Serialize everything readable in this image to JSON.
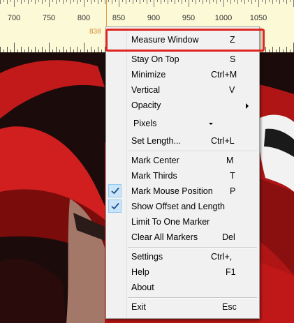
{
  "ruler": {
    "labels": [
      "700",
      "750",
      "800",
      "850",
      "900",
      "950",
      "1000",
      "1050"
    ],
    "mouse_position": "838"
  },
  "menu": {
    "items": [
      {
        "label": "Measure Window",
        "shortcut": "Z"
      },
      {
        "label": "Stay On Top",
        "shortcut": "S"
      },
      {
        "label": "Minimize",
        "shortcut": "Ctrl+M"
      },
      {
        "label": "Vertical",
        "shortcut": "V"
      },
      {
        "label": "Opacity",
        "shortcut": ""
      },
      {
        "label": "Set Length...",
        "shortcut": "Ctrl+L"
      },
      {
        "label": "Mark Center",
        "shortcut": "M"
      },
      {
        "label": "Mark Thirds",
        "shortcut": "T"
      },
      {
        "label": "Mark Mouse Position",
        "shortcut": "P",
        "checked": true
      },
      {
        "label": "Show Offset and Length",
        "shortcut": "",
        "checked": true
      },
      {
        "label": "Limit To One Marker",
        "shortcut": ""
      },
      {
        "label": "Clear All Markers",
        "shortcut": "Del"
      },
      {
        "label": "Settings",
        "shortcut": "Ctrl+,"
      },
      {
        "label": "Help",
        "shortcut": "F1"
      },
      {
        "label": "About",
        "shortcut": ""
      },
      {
        "label": "Exit",
        "shortcut": "Esc"
      }
    ],
    "units_select": {
      "value": "Pixels"
    }
  },
  "colors": {
    "ruler_bg": "#fbf9d6",
    "highlight": "#e0241f",
    "menu_bg": "#f1f1f1",
    "check_bg": "#cce4f7"
  }
}
